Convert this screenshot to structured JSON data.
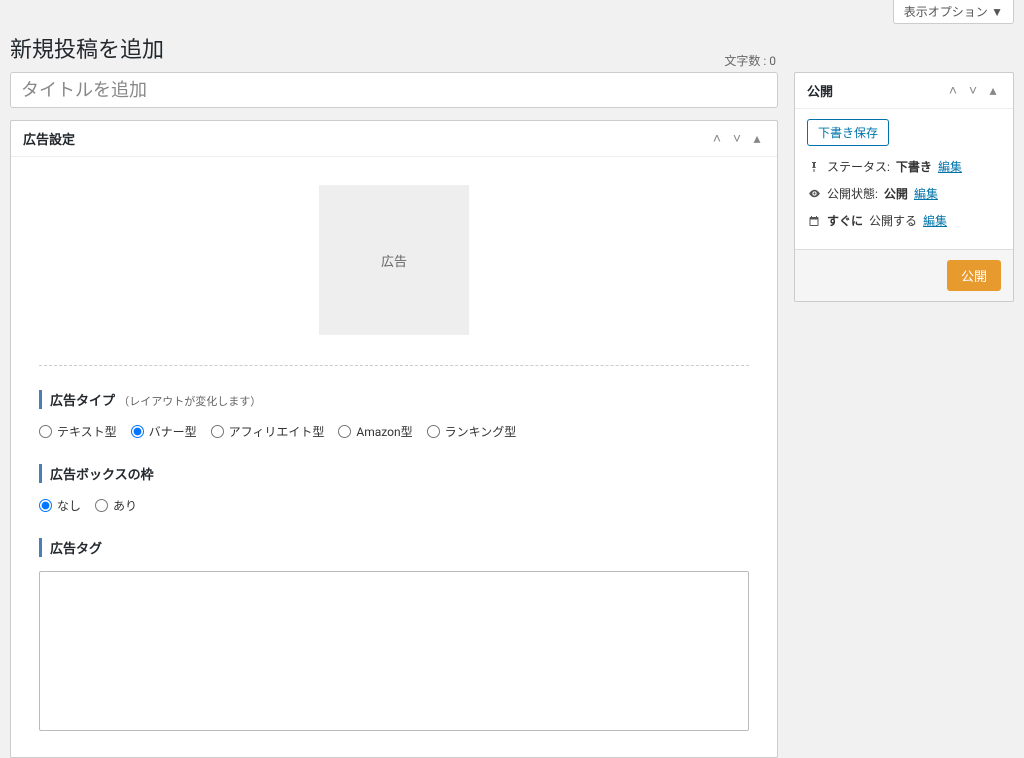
{
  "screen_options": {
    "label": "表示オプション ▼"
  },
  "page": {
    "title": "新規投稿を追加"
  },
  "char_count": {
    "label_prefix": "文字数 : ",
    "value": "0"
  },
  "title_input": {
    "placeholder": "タイトルを追加"
  },
  "ad_settings_box": {
    "title": "広告設定",
    "preview_label": "広告",
    "type_label": "広告タイプ",
    "type_note": "（レイアウトが変化します）",
    "type_options": [
      {
        "label": "テキスト型",
        "checked": false
      },
      {
        "label": "バナー型",
        "checked": true
      },
      {
        "label": "アフィリエイト型",
        "checked": false
      },
      {
        "label": "Amazon型",
        "checked": false
      },
      {
        "label": "ランキング型",
        "checked": false
      }
    ],
    "border_label": "広告ボックスの枠",
    "border_options": [
      {
        "label": "なし",
        "checked": true
      },
      {
        "label": "あり",
        "checked": false
      }
    ],
    "tag_label": "広告タグ"
  },
  "publish_box": {
    "title": "公開",
    "draft_button": "下書き保存",
    "status": {
      "label": "ステータス:",
      "value": "下書き",
      "edit": "編集"
    },
    "visibility": {
      "label": "公開状態:",
      "value": "公開",
      "edit": "編集"
    },
    "schedule": {
      "label_prefix": "すぐに",
      "label_suffix": "公開する",
      "edit": "編集"
    },
    "publish_button": "公開"
  }
}
